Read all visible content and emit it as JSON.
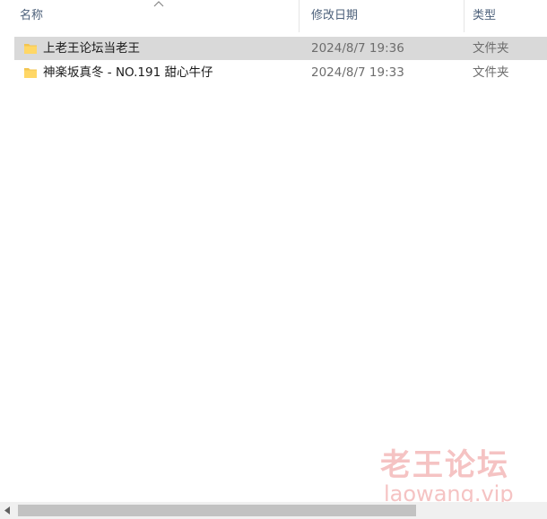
{
  "header": {
    "columns": [
      {
        "label": "名称"
      },
      {
        "label": "修改日期"
      },
      {
        "label": "类型"
      }
    ],
    "sort_icon": "chevron-up-icon"
  },
  "files": [
    {
      "name": "上老王论坛当老王",
      "modified": "2024/8/7 19:36",
      "type": "文件夹",
      "selected": true,
      "icon": "folder-icon"
    },
    {
      "name": "神楽坂真冬 - NO.191 甜心牛仔",
      "modified": "2024/8/7 19:33",
      "type": "文件夹",
      "selected": false,
      "icon": "folder-icon"
    }
  ],
  "watermark": {
    "title": "老王论坛",
    "url": "laowang.vip"
  },
  "colors": {
    "selected_row": "#d9d9d9",
    "header_text": "#4c607a",
    "folder": "#ffd766",
    "watermark": "#f5c3c3"
  }
}
